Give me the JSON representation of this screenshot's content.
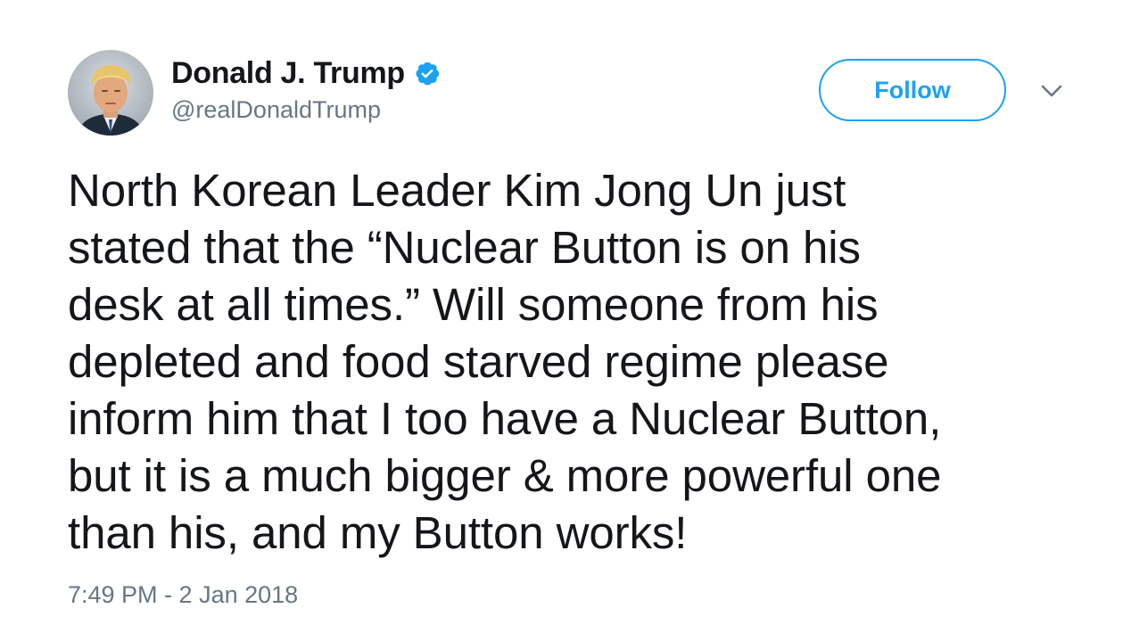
{
  "author": {
    "display_name": "Donald J. Trump",
    "handle": "@realDonaldTrump",
    "verified": true,
    "avatar_icon": "profile-photo"
  },
  "actions": {
    "follow_label": "Follow",
    "menu_icon": "chevron-down-icon"
  },
  "tweet": {
    "lines": [
      "North Korean Leader Kim Jong Un just",
      "stated that the “Nuclear Button is on his",
      "desk at all times.” Will someone from his",
      "depleted and food starved regime please",
      "inform him that I too have a Nuclear Button,",
      "but it is a much bigger & more powerful one",
      "than his, and my Button works!"
    ],
    "timestamp": "7:49 PM - 2 Jan 2018"
  },
  "colors": {
    "accent": "#1da1f2",
    "text": "#14171a",
    "secondary": "#657786",
    "background": "#ffffff"
  }
}
